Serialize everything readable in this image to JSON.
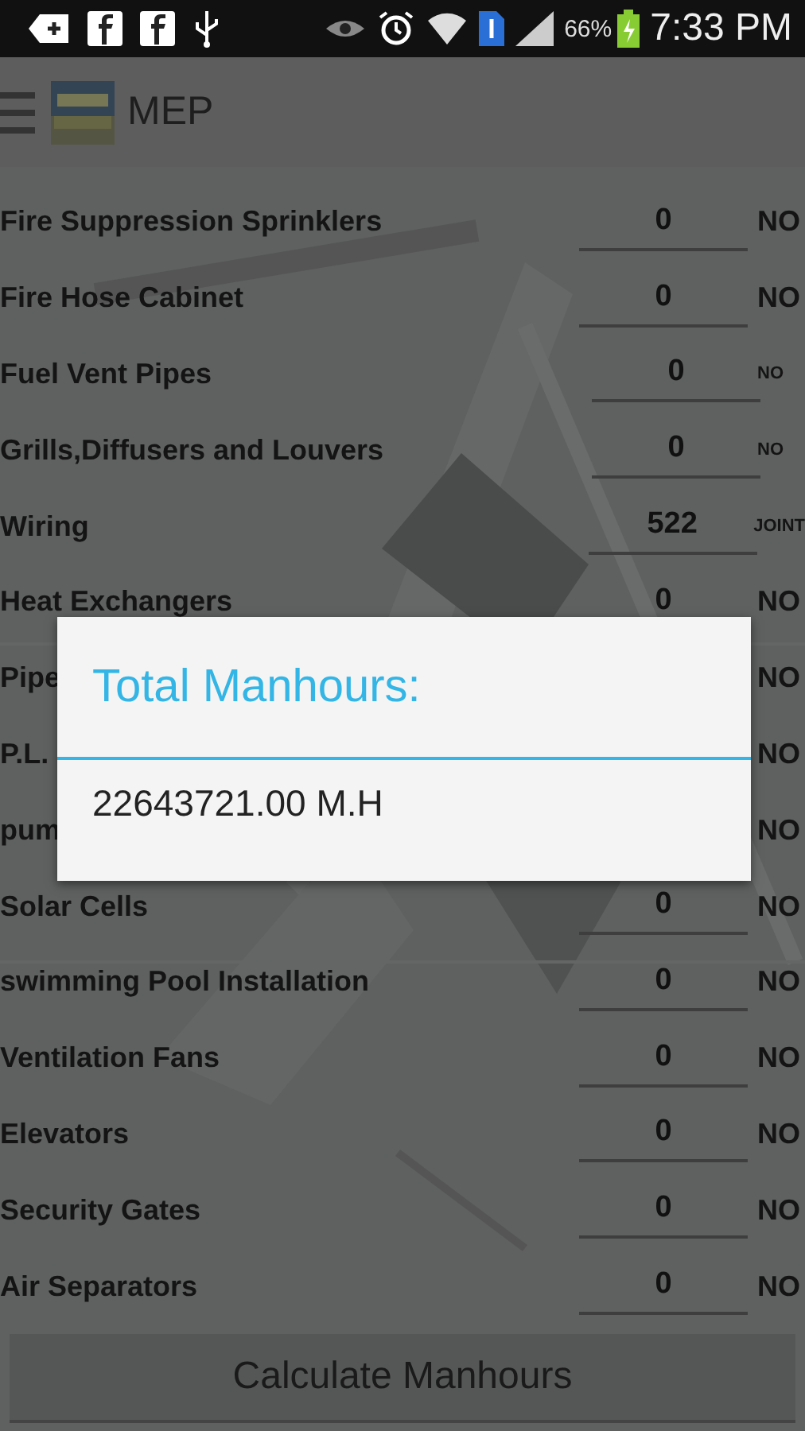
{
  "status_bar": {
    "battery": "66%",
    "time": "7:33 PM"
  },
  "app_bar": {
    "title": "MEP"
  },
  "rows": [
    {
      "name": "Fire Suppression Sprinklers",
      "value": "0",
      "unit": "NO",
      "unit_small": false
    },
    {
      "name": "Fire Hose Cabinet",
      "value": "0",
      "unit": "NO",
      "unit_small": false
    },
    {
      "name": "Fuel Vent Pipes",
      "value": "0",
      "unit": "NO",
      "unit_small": true
    },
    {
      "name": "Grills,Diffusers and Louvers",
      "value": "0",
      "unit": "NO",
      "unit_small": true
    },
    {
      "name": "Wiring",
      "value": "522",
      "unit": "JOINT",
      "unit_small": true
    },
    {
      "name": "Heat Exchangers",
      "value": "0",
      "unit": "NO",
      "unit_small": false
    },
    {
      "name": "Pipe",
      "unit": "NO",
      "unit_small": false
    },
    {
      "name": "P.L.",
      "unit": "NO",
      "unit_small": false
    },
    {
      "name": "pum",
      "unit": "NO",
      "unit_small": false
    },
    {
      "name": "Solar Cells",
      "value": "0",
      "unit": "NO",
      "unit_small": false
    },
    {
      "name": "swimming Pool Installation",
      "value": "0",
      "unit": "NO",
      "unit_small": false
    },
    {
      "name": "Ventilation Fans",
      "value": "0",
      "unit": "NO",
      "unit_small": false
    },
    {
      "name": "Elevators",
      "value": "0",
      "unit": "NO",
      "unit_small": false
    },
    {
      "name": "Security Gates",
      "value": "0",
      "unit": "NO",
      "unit_small": false
    },
    {
      "name": "Air Separators",
      "value": "0",
      "unit": "NO",
      "unit_small": false
    }
  ],
  "button": "Calculate Manhours",
  "dialog": {
    "title": "Total Manhours:",
    "message": "22643721.00 M.H"
  }
}
